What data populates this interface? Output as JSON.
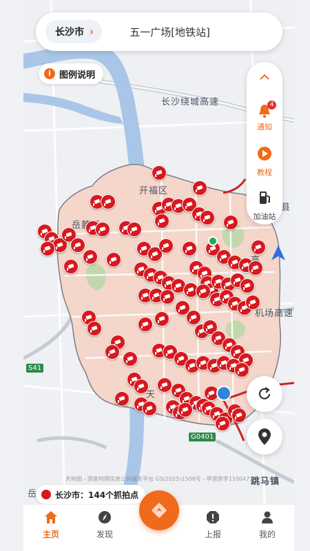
{
  "search": {
    "city": "长沙市",
    "query": "五一广场[地铁站]"
  },
  "legend": {
    "label": "图例说明"
  },
  "tools": {
    "notice_label": "通知",
    "notice_badge": "4",
    "tutorial_label": "教程",
    "gas_label": "加油站"
  },
  "map": {
    "labels": {
      "ring_road": "长沙绕城高速",
      "kaifu": "开福区",
      "yuelu": "岳麓区",
      "airport_highway": "机场高速",
      "tianxin": "天",
      "xian": "县",
      "gao": "高",
      "yue": "岳",
      "tiaoma": "跳马镇",
      "s41": "S41",
      "g0401": "G0401"
    },
    "copyright": "天地图 - 国家地理信息公共服务平台 GS(2025)1508号 - 甲测资字1100471"
  },
  "status": {
    "count_text": "长沙市：144个抓拍点"
  },
  "nav": {
    "home": "主页",
    "discover": "发现",
    "report": "上报",
    "mine": "我的"
  },
  "colors": {
    "accent": "#f06a1c",
    "pin": "#d7191f",
    "area_fill": "#f4d6ca"
  }
}
